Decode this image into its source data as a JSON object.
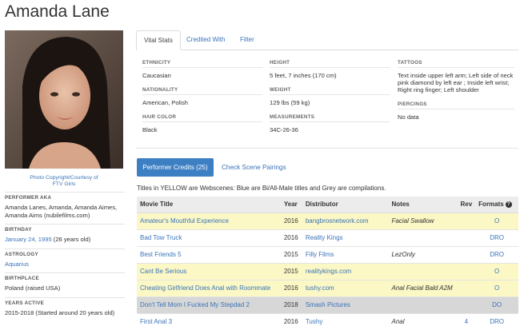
{
  "performer": {
    "name": "Amanda Lane",
    "photo_credit_line1": "Photo Copyright/Courtesy of",
    "photo_credit_line2": "FTV Girls"
  },
  "sidebar": {
    "aka_label": "PERFORMER AKA",
    "aka_value": "Amanda Lanes, Amanda, Amanda Aimes, Amanda Aims (nubilefilms.com)",
    "birthday_label": "BIRTHDAY",
    "birthday_link": "January 24, 1995",
    "birthday_age": " (26 years old)",
    "astrology_label": "ASTROLOGY",
    "astrology_value": "Aquarius",
    "birthplace_label": "BIRTHPLACE",
    "birthplace_value": "Poland (raised USA)",
    "years_label": "YEARS ACTIVE",
    "years_value": "2015-2018 (Started around 20 years old)"
  },
  "tabs": [
    "Vital Stats",
    "Credited With",
    "Filter"
  ],
  "stats": {
    "ethnicity_label": "ETHNICITY",
    "ethnicity": "Caucasian",
    "nationality_label": "NATIONALITY",
    "nationality": "American, Polish",
    "hair_label": "HAIR COLOR",
    "hair": "Black",
    "height_label": "HEIGHT",
    "height": "5 feet, 7 inches (170 cm)",
    "weight_label": "WEIGHT",
    "weight": "129 lbs (59 kg)",
    "measurements_label": "MEASUREMENTS",
    "measurements": "34C-26-36",
    "tattoos_label": "TATTOOS",
    "tattoos": "Text inside upper left arm; Left side of neck pink diamond by left ear ; Inside left wrist; Right ring finger; Left shoulder",
    "piercings_label": "PIERCINGS",
    "piercings": "No data"
  },
  "credits": {
    "button_label": "Performer Credits (25)",
    "pairings_label": "Check Scene Pairings",
    "legend": "Titles in YELLOW are Webscenes: Blue are Bi/All-Male titles and Grey are compilations.",
    "headers": {
      "title": "Movie Title",
      "year": "Year",
      "distributor": "Distributor",
      "notes": "Notes",
      "rev": "Rev",
      "formats": "Formats"
    },
    "rows": [
      {
        "title": "Amateur's Mouthful Experience",
        "year": "2016",
        "distributor": "bangbrosnetwork.com",
        "notes": "Facial Swallow",
        "rev": "",
        "formats": "O",
        "type": "yellow"
      },
      {
        "title": "Bad Tow Truck",
        "year": "2016",
        "distributor": "Reality Kings",
        "notes": "",
        "rev": "",
        "formats": "DRO",
        "type": "white"
      },
      {
        "title": "Best Friends 5",
        "year": "2015",
        "distributor": "Filly Films",
        "notes": "LezOnly",
        "rev": "",
        "formats": "DRO",
        "type": "white"
      },
      {
        "title": "Cant Be Serious",
        "year": "2015",
        "distributor": "realitykings.com",
        "notes": "",
        "rev": "",
        "formats": "O",
        "type": "yellow"
      },
      {
        "title": "Cheating Girlfriend Does Anal with Roommate",
        "year": "2016",
        "distributor": "tushy.com",
        "notes": "Anal Facial Bald A2M",
        "rev": "",
        "formats": "O",
        "type": "yellow"
      },
      {
        "title": "Don't Tell Mom I Fucked My Stepdad 2",
        "year": "2018",
        "distributor": "Smash Pictures",
        "notes": "",
        "rev": "",
        "formats": "DO",
        "type": "grey"
      },
      {
        "title": "First Anal 3",
        "year": "2016",
        "distributor": "Tushy",
        "notes": "Anal",
        "rev": "4",
        "formats": "DRO",
        "type": "white"
      }
    ]
  }
}
